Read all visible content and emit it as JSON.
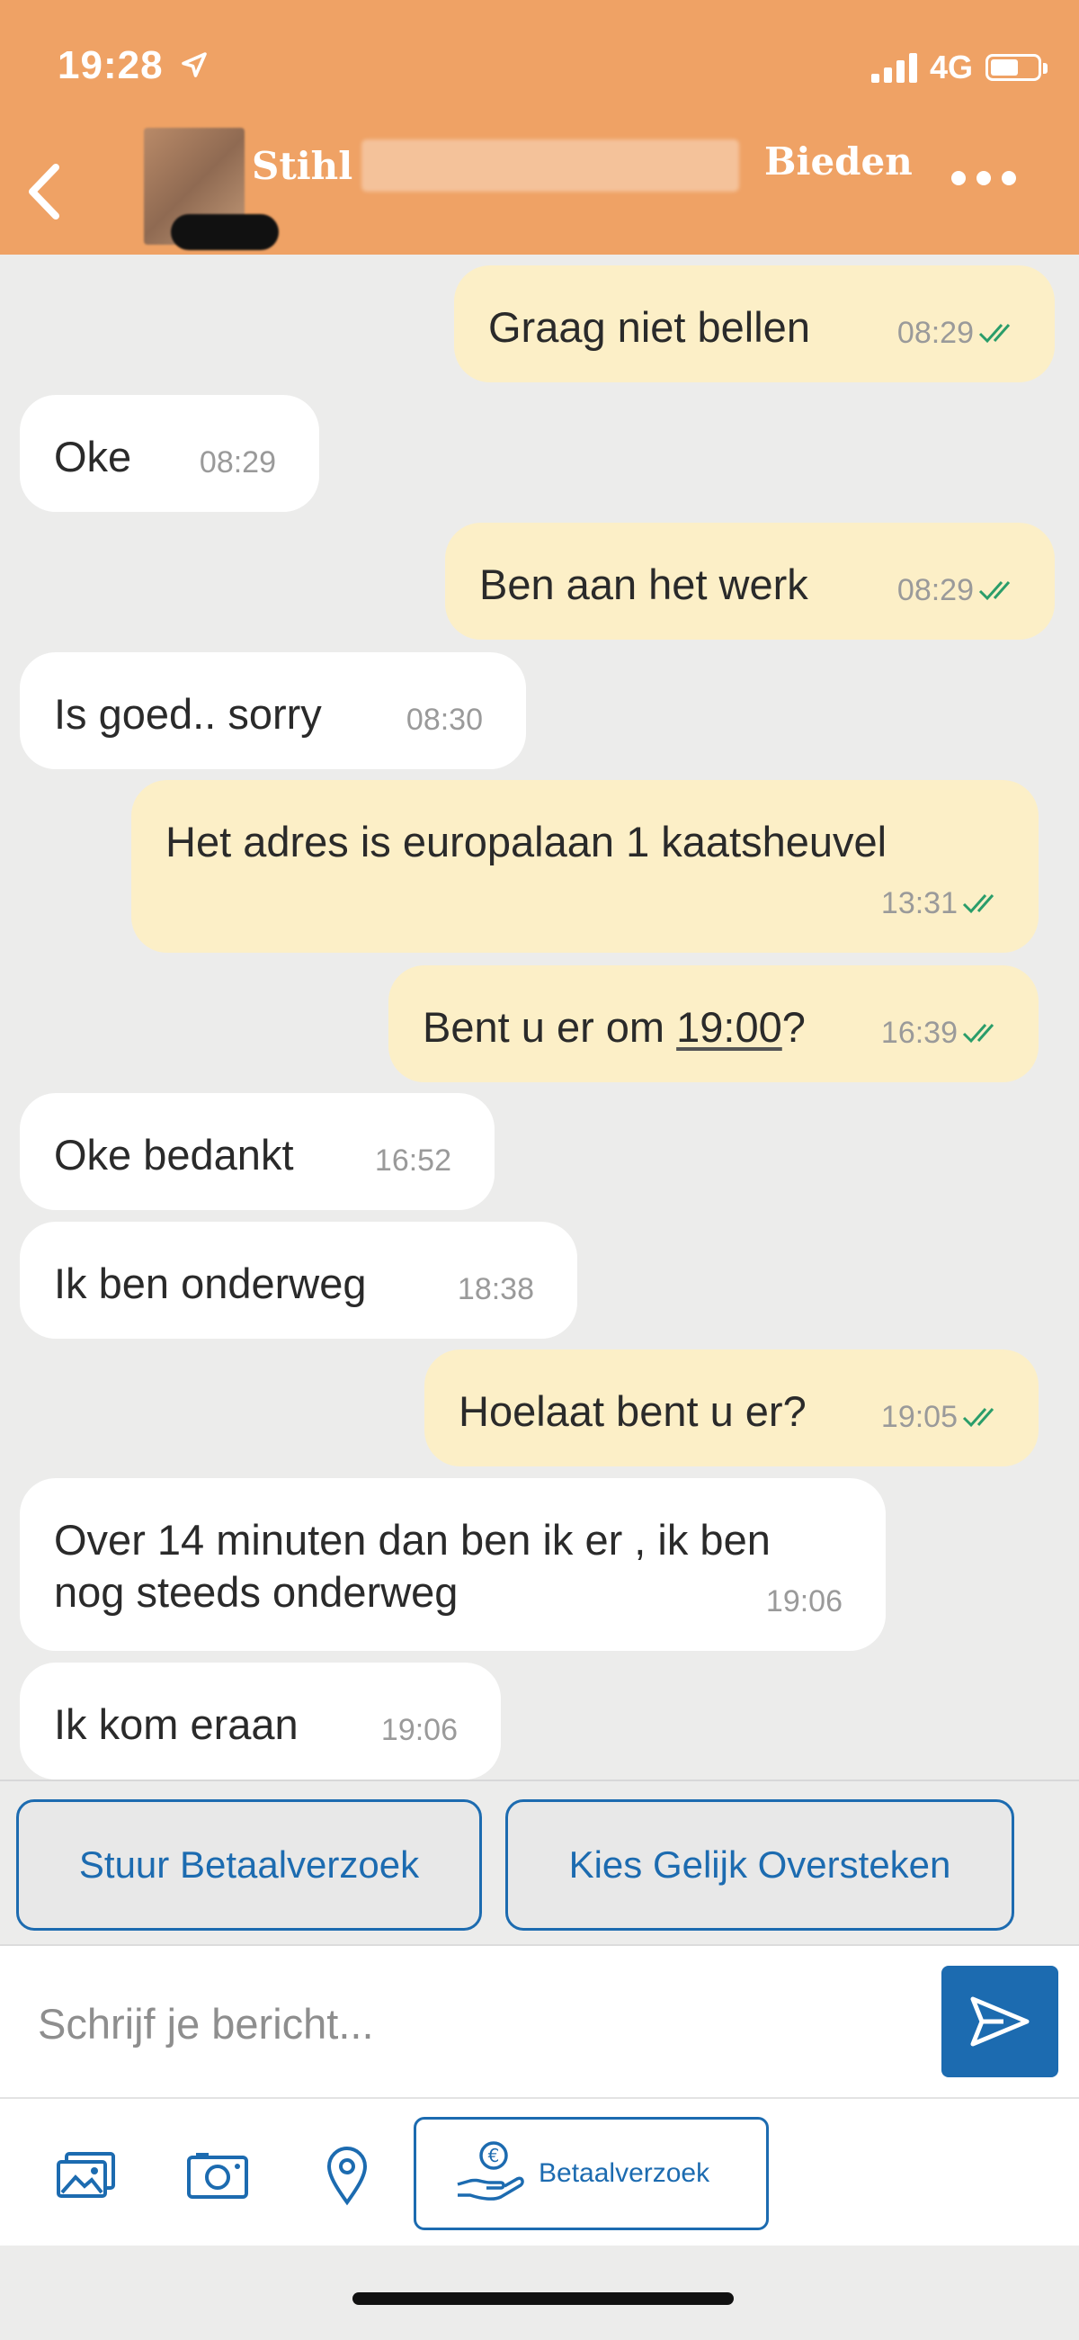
{
  "status_bar": {
    "time": "19:28",
    "network": "4G"
  },
  "header": {
    "title": "Stihl",
    "bid_label": "Bieden"
  },
  "messages": [
    {
      "dir": "out",
      "text": "Graag niet bellen",
      "time": "08:29"
    },
    {
      "dir": "in",
      "text": "Oke",
      "time": "08:29"
    },
    {
      "dir": "out",
      "text": "Ben aan het werk",
      "time": "08:29"
    },
    {
      "dir": "in",
      "text": "Is goed.. sorry",
      "time": "08:30"
    },
    {
      "dir": "out",
      "text": "Het adres is europalaan 1 kaatsheuvel",
      "time": "13:31"
    },
    {
      "dir": "out",
      "text_before": "Bent u er om ",
      "text_time": "19:00",
      "text_after": "?",
      "time": "16:39"
    },
    {
      "dir": "in",
      "text": "Oke bedankt",
      "time": "16:52"
    },
    {
      "dir": "in",
      "text": "Ik ben onderweg",
      "time": "18:38"
    },
    {
      "dir": "out",
      "text": "Hoelaat bent u er?",
      "time": "19:05"
    },
    {
      "dir": "in",
      "text": "Over 14 minuten dan ben ik er , ik ben\nnog steeds onderweg",
      "time": "19:06"
    },
    {
      "dir": "in",
      "text": "Ik kom eraan",
      "time": "19:06"
    }
  ],
  "actions": {
    "payment_request": "Stuur Betaalverzoek",
    "equal_crossing": "Kies Gelijk Oversteken"
  },
  "compose": {
    "placeholder": "Schrijf je bericht..."
  },
  "toolbar": {
    "pay_label": "Betaalverzoek"
  },
  "colors": {
    "header": "#efa265",
    "accent": "#1c6bb0",
    "outgoing": "#fcefc7",
    "incoming": "#ffffff",
    "read_tick": "#2a9d6a"
  }
}
